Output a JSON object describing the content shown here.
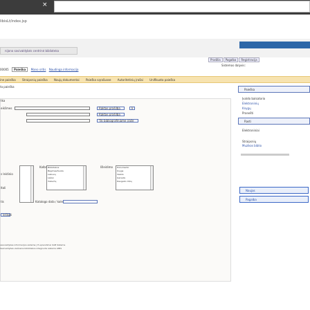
{
  "browser": {
    "close_glyph": "×",
    "url": "libisLt/index.jsp"
  },
  "header": {
    "banner_label": "nijono savivaldybės centrinė biblioteka",
    "languages": [
      "Pradžia",
      "Pagalba",
      "Registracija"
    ],
    "selected_docs": "Sistemos dalyvis:"
  },
  "tabs": {
    "first_prefix": "00005",
    "items": [
      {
        "label": "Paieška",
        "style": "first"
      },
      {
        "label": "Mano sritis",
        "style": "link"
      },
      {
        "label": "Naudinga informacija",
        "style": "link"
      }
    ]
  },
  "navbar": {
    "items": [
      "ine paieška",
      "Straipsnių paieška",
      "Naujų dokumentai",
      "Paieška sąrašuose",
      "Autoritetinių įrašai",
      "Unifikuota paieška"
    ]
  },
  "subtitle": "ta paieška",
  "search": {
    "section_label": "tka",
    "keyword_label": "eikšmes",
    "field_selects": [
      "Raktas prašilba",
      "Raktas prašilba",
      "Tik bibliografiniame įraše"
    ],
    "bool_select": "Ir"
  },
  "filters": {
    "col1_labels": [
      "s leidinio",
      "ltali",
      "tis"
    ],
    "type_label": "Kalba",
    "type_box": [
      "Bibliotekos",
      "Bėgimas/Šuolis",
      "Lietuvių",
      "Lėšiai",
      "Vokiečių"
    ],
    "status_label": "Išleidimo",
    "status_box": [
      "Dokumento",
      "Knyga",
      "Vaizdo",
      "Garsalis",
      "Daugelio rūšių"
    ],
    "catalog_label": "Katalogo data / kolekcija"
  },
  "panel_buttons": {
    "small_btn": "Ieškoti"
  },
  "footer": {
    "line1": "savivaldybės informacijos sistema | E-sprendimai UAB Sistema",
    "line2": "Savivaldybės viešosios bibliotekos integruota sistema LIBIS"
  },
  "sidebar": {
    "btn_top": "Paieška",
    "labels": [
      "Įvaldo balsatorio",
      "Elektroninių",
      "Knygų",
      "Pranešti",
      "Elektroniniai",
      "Straipsnių"
    ],
    "highlight": "Muzikos biblio",
    "btn_mid": "Rasti",
    "go_new": "Naujas",
    "go_help": "Pagalba"
  }
}
